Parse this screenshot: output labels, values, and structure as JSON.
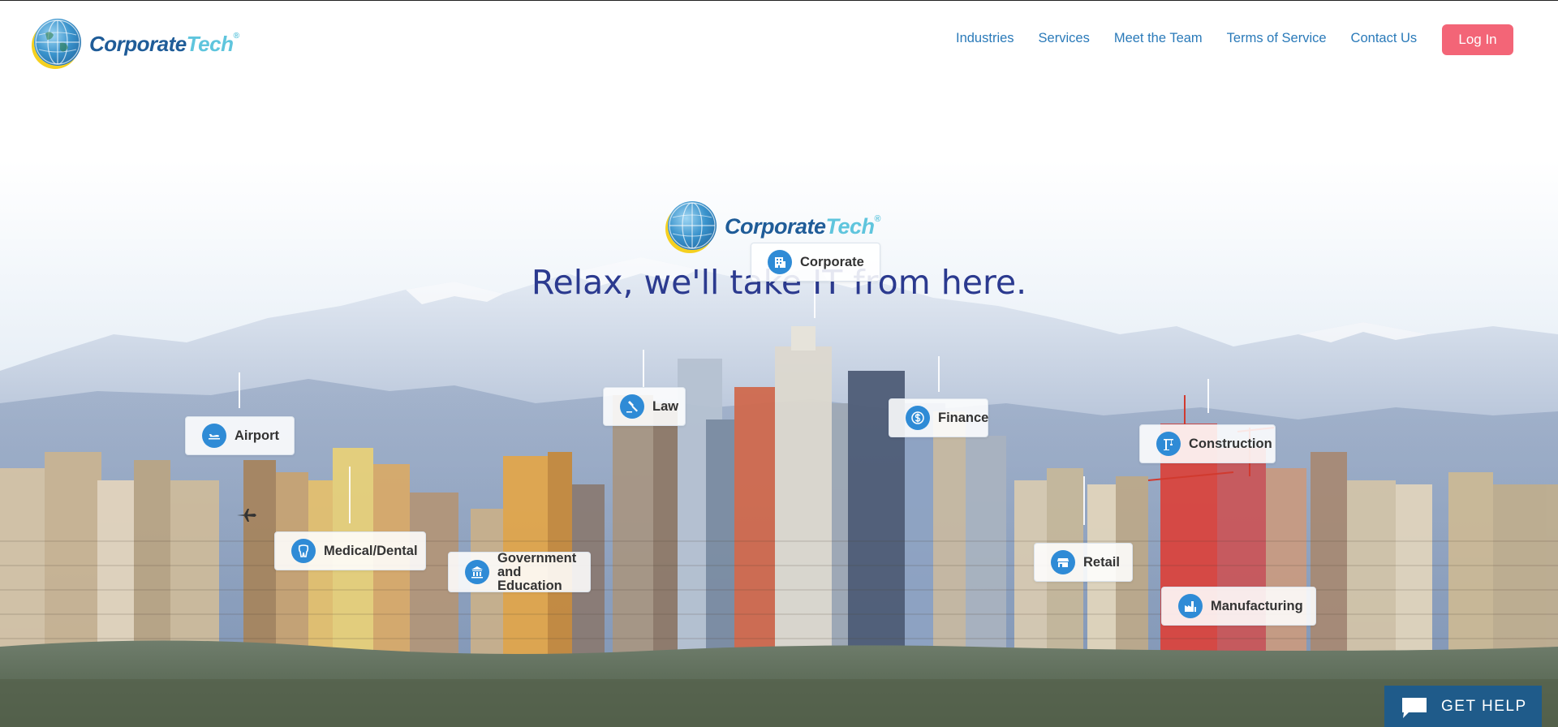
{
  "header": {
    "logo": {
      "corporate": "Corporate",
      "tech": "Tech",
      "reg": "®"
    },
    "nav": [
      "Industries",
      "Services",
      "Meet the Team",
      "Terms of Service",
      "Contact Us"
    ],
    "login_label": "Log In"
  },
  "hero": {
    "logo": {
      "corporate": "Corporate",
      "tech": "Tech",
      "reg": "®"
    },
    "tagline": "Relax, we'll take IT from here.",
    "industries": [
      {
        "label": "Airport",
        "icon": "airplane-icon"
      },
      {
        "label": "Medical/Dental",
        "icon": "tooth-icon"
      },
      {
        "label": "Government and Education",
        "icon": "government-building-icon"
      },
      {
        "label": "Law",
        "icon": "gavel-icon"
      },
      {
        "label": "Corporate",
        "icon": "office-building-icon"
      },
      {
        "label": "Finance",
        "icon": "dollar-icon"
      },
      {
        "label": "Construction",
        "icon": "crane-icon"
      },
      {
        "label": "Retail",
        "icon": "storefront-icon"
      },
      {
        "label": "Manufacturing",
        "icon": "factory-icon"
      }
    ]
  },
  "help_widget": {
    "label": "GET HELP",
    "icon": "chat-bubble-icon"
  },
  "colors": {
    "nav_link": "#2a7ab9",
    "login_button": "#f36577",
    "tagline": "#2b3a8f",
    "icon_circle": "#2f8bd6",
    "help_widget": "#1f5b8a",
    "logo_dark": "#1f5c98",
    "logo_light": "#5fc5dd"
  }
}
